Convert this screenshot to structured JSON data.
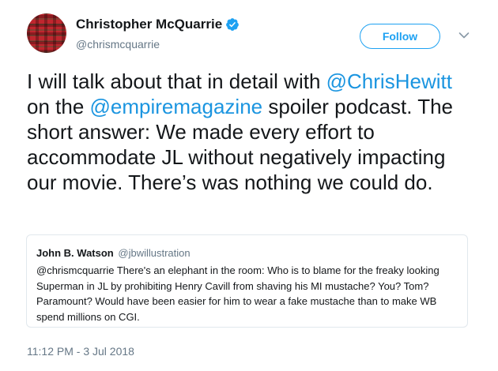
{
  "author": {
    "name": "Christopher McQuarrie",
    "handle": "@chrismcquarrie"
  },
  "follow_button": {
    "label": "Follow"
  },
  "tweet": {
    "segments": [
      {
        "text": "I will talk about that in detail with ",
        "mention": false
      },
      {
        "text": "@ChrisHewitt",
        "mention": true
      },
      {
        "text": " on the ",
        "mention": false
      },
      {
        "text": "@empiremagazine",
        "mention": true
      },
      {
        "text": " spoiler podcast. The short answer: We made every effort to accommodate JL without negatively impacting our movie. There’s was nothing we could do.",
        "mention": false
      }
    ],
    "timestamp": "11:12 PM - 3 Jul 2018"
  },
  "quoted_tweet": {
    "name": "John B. Watson",
    "handle": "@jbwillustration",
    "text": "@chrismcquarrie There's an elephant in the room: Who is to blame for the freaky looking Superman in JL by prohibiting Henry Cavill from shaving his MI mustache? You? Tom? Paramount? Would have been easier for him to wear a fake mustache than to make WB spend millions on CGI."
  },
  "colors": {
    "accent": "#1da1f2",
    "mention": "#1b95e0",
    "secondary_text": "#657786",
    "border": "#e1e8ed"
  },
  "icons": {
    "verified": "verified-badge-icon",
    "caret": "chevron-down-icon"
  }
}
